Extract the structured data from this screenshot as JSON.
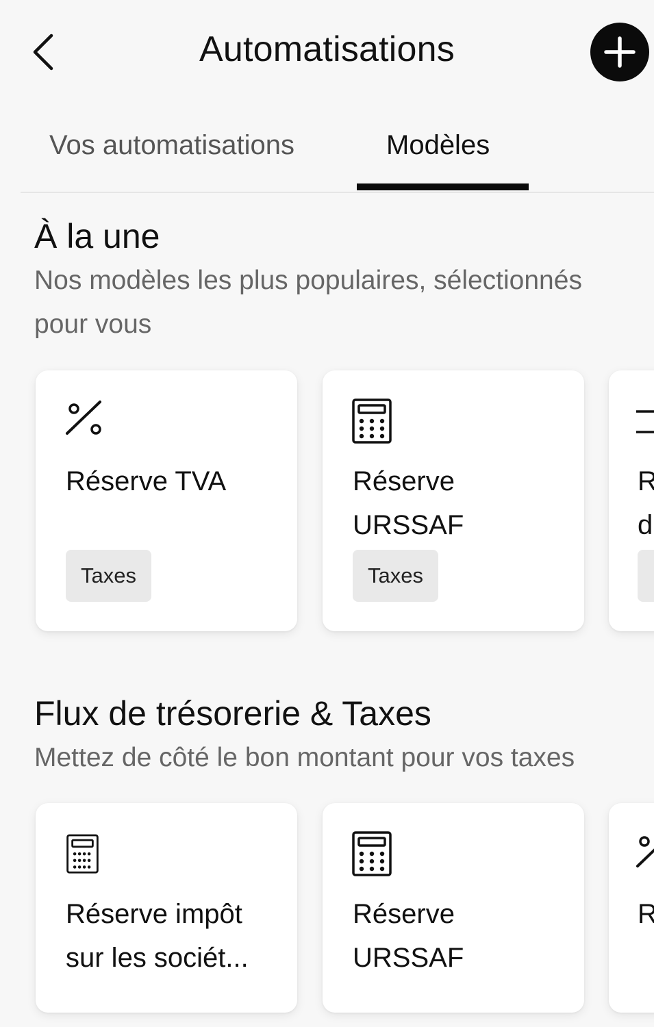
{
  "header": {
    "title": "Automatisations"
  },
  "tabs": [
    {
      "label": "Vos automatisations",
      "active": false
    },
    {
      "label": "Modèles",
      "active": true
    }
  ],
  "featured": {
    "title": "À la une",
    "subtitle_line1": "Nos modèles les plus populaires, sélectionnés",
    "subtitle_line2": "pour vous",
    "cards": [
      {
        "icon": "percent-icon",
        "title_line1": "Réserve TVA",
        "title_line2": "",
        "tag": "Taxes"
      },
      {
        "icon": "calculator-icon",
        "title_line1": "Réserve",
        "title_line2": "URSSAF",
        "tag": "Taxes"
      },
      {
        "icon": "split-icon",
        "title_line1": "R",
        "title_line2": "d",
        "tag": ""
      }
    ]
  },
  "cashflow": {
    "title": "Flux de trésorerie & Taxes",
    "subtitle": "Mettez de côté le bon montant pour vos taxes",
    "cards": [
      {
        "icon": "calculator-icon",
        "title_line1": "Réserve impôt",
        "title_line2": "sur les sociét..."
      },
      {
        "icon": "calculator-icon",
        "title_line1": "Réserve",
        "title_line2": "URSSAF"
      },
      {
        "icon": "percent-icon",
        "title_line1": "R",
        "title_line2": ""
      }
    ]
  },
  "colors": {
    "background": "#f7f7f7",
    "accent": "#0b0b0b",
    "chip": "#e9e9e9"
  }
}
